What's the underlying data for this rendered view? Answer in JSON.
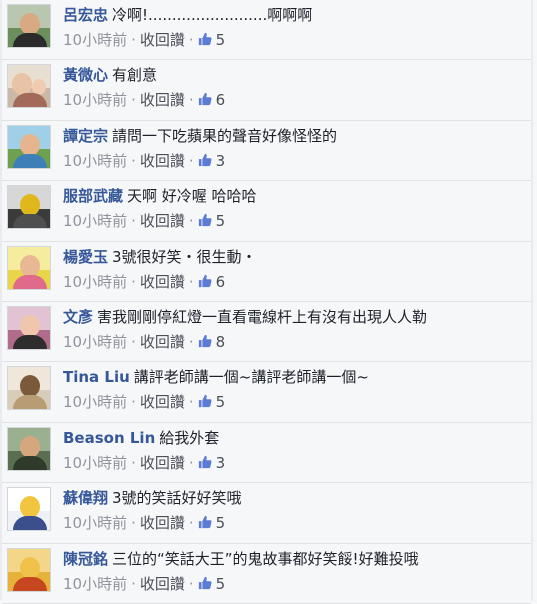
{
  "comments": [
    {
      "author": "呂宏忠",
      "text": "冷啊!.........................啊啊啊",
      "time": "10小時前",
      "action": "收回讚",
      "likes": "5",
      "avatar": {
        "bg": "#6a8f5a",
        "sky": "#b9c7b1",
        "head": "#d9a982",
        "body": "#2b2b2b"
      }
    },
    {
      "author": "黃微心",
      "text": "有創意",
      "time": "10小時前",
      "action": "收回讚",
      "likes": "6",
      "avatar": {
        "bg": "#c9b9a6",
        "sky": "#e8dfd3",
        "head": "#e9c3a5",
        "body": "#a36a5a",
        "head2": "#f0cbb0"
      }
    },
    {
      "author": "譚定宗",
      "text": "請問一下吃蘋果的聲音好像怪怪的",
      "time": "10小時前",
      "action": "收回讚",
      "likes": "3",
      "avatar": {
        "bg": "#6fa04f",
        "sky": "#9fd0e8",
        "head": "#e6b58d",
        "body": "#3f7fb8"
      }
    },
    {
      "author": "服部武藏",
      "text": "天啊 好冷喔 哈哈哈",
      "time": "10小時前",
      "action": "收回讚",
      "likes": "5",
      "avatar": {
        "bg": "#3b3b3b",
        "sky": "#d7d7d7",
        "head": "#e0b81c",
        "body": "#4f4f4f"
      }
    },
    {
      "author": "楊愛玉",
      "text": "3號很好笑・很生動・",
      "time": "10小時前",
      "action": "收回讚",
      "likes": "6",
      "avatar": {
        "bg": "#e8d54a",
        "sky": "#f6ec9e",
        "head": "#e8b894",
        "body": "#e06a8a"
      }
    },
    {
      "author": "文彥",
      "text": "害我剛剛停紅燈一直看電線杆上有沒有出現人人勒",
      "time": "10小時前",
      "action": "收回讚",
      "likes": "8",
      "avatar": {
        "bg": "#b06c8a",
        "sky": "#e2c3d3",
        "head": "#f0c6ad",
        "body": "#2d2d2d"
      }
    },
    {
      "author": "Tina Liu",
      "text": "講評老師講一個~講評老師講一個~",
      "time": "10小時前",
      "action": "收回讚",
      "likes": "5",
      "avatar": {
        "bg": "#d8cdb8",
        "sky": "#efe8da",
        "head": "#7a5a3a",
        "body": "#b79c74"
      }
    },
    {
      "author": "Beason Lin",
      "text": "給我外套",
      "time": "10小時前",
      "action": "收回讚",
      "likes": "3",
      "avatar": {
        "bg": "#5a6e52",
        "sky": "#9bb08e",
        "head": "#d6a77f",
        "body": "#2f3a2a"
      }
    },
    {
      "author": "蘇偉翔",
      "text": "3號的笑話好好笑哦",
      "time": "10小時前",
      "action": "收回讚",
      "likes": "5",
      "avatar": {
        "bg": "#eef1f5",
        "sky": "#ffffff",
        "head": "#f2c541",
        "body": "#3a4f8c"
      }
    },
    {
      "author": "陳冠銘",
      "text": "三位的“笑話大王”的鬼故事都好笑餒!好難投哦",
      "time": "10小時前",
      "action": "收回讚",
      "likes": "5",
      "avatar": {
        "bg": "#e7b23a",
        "sky": "#f4d689",
        "head": "#f1c24a",
        "body": "#c5461f"
      }
    }
  ],
  "icons": {
    "like": "thumbs-up-icon"
  },
  "colors": {
    "author": "#365899",
    "meta": "#90949c",
    "accent": "#4267b2"
  }
}
